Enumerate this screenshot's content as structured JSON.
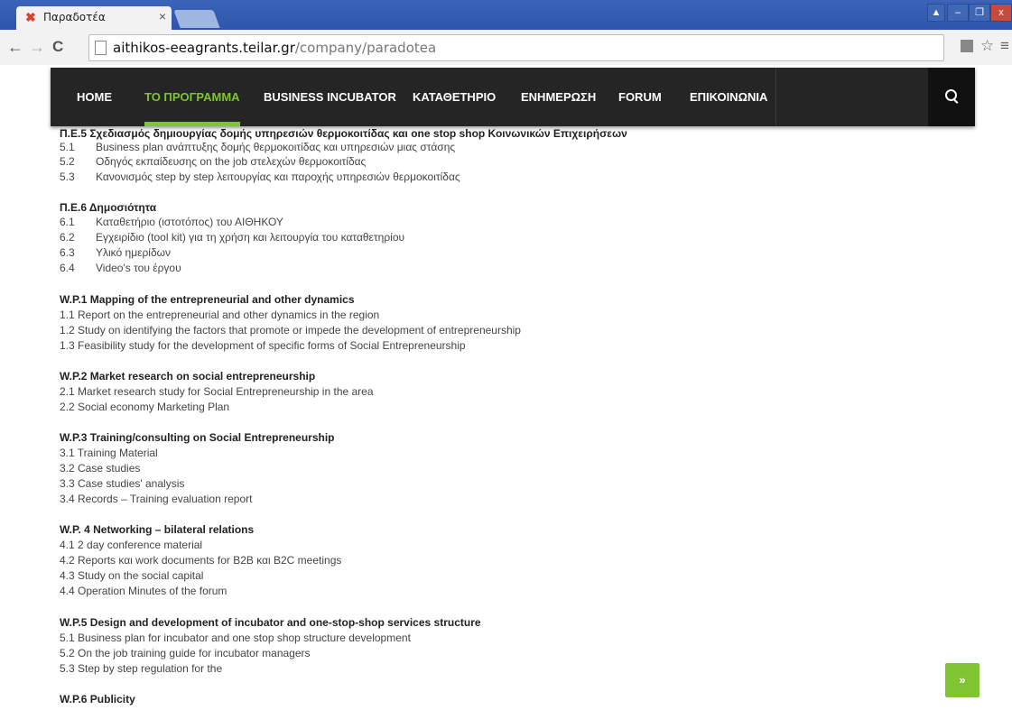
{
  "browser": {
    "tab_title": "Παραδοτέα",
    "tab_close": "×",
    "url_host": "aithikos-eeagrants.teilar.gr",
    "url_path": "/company/paradotea",
    "icons": {
      "back": "←",
      "forward": "→",
      "reload": "C",
      "translate": "​",
      "bookmark": "☆",
      "menu": "≡"
    },
    "window_controls": [
      "▲",
      "–",
      "❐",
      "x"
    ]
  },
  "nav": {
    "items": [
      "HOME",
      "ΤΟ ΠΡΟΓΡΑΜΜΑ",
      "BUSINESS INCUBATOR",
      "ΚΑΤΑΘΕΤΗΡΙΟ",
      "ΕΝΗΜΕΡΩΣΗ",
      "FORUM",
      "ΕΠΙΚΟΙΝΩΝΙΑ"
    ],
    "active": "ΤΟ ΠΡΟΓΡΑΜΜΑ"
  },
  "content": {
    "partial_heading": "Π.Ε.5 Σχεδιασμός δημιουργίας δομής υπηρεσιών θερμοκοιτίδας και one stop shop Κοινωνικών Επιχειρήσεων",
    "pe5": [
      {
        "num": "5.1",
        "text": "Business plan ανάπτυξης δομής θερμοκοιτίδας και υπηρεσιών μιας στάσης"
      },
      {
        "num": "5.2",
        "text": "Οδηγός εκπαίδευσης on the job στελεχών θερμοκοιτίδας"
      },
      {
        "num": "5.3",
        "text": "Κανονισμός step by step λειτουργίας και παροχής υπηρεσιών θερμοκοιτίδας"
      }
    ],
    "pe6_title": "Π.Ε.6 Δημοσιότητα",
    "pe6": [
      {
        "num": "6.1",
        "text": "Καταθετήριο (ιστοτόπος) του ΑΙΘΗΚΟΥ"
      },
      {
        "num": "6.2",
        "text": "Εγχειρίδιο (tool kit) για τη χρήση και λειτουργία του καταθετηρίου"
      },
      {
        "num": "6.3",
        "text": "Υλικό ημερίδων"
      },
      {
        "num": "6.4",
        "text": "Video's του έργου"
      }
    ],
    "wp1_title": "W.P.1 Mapping of the entrepreneurial and other dynamics",
    "wp1": [
      "1.1 Report on the entrepreneurial and other dynamics in the region",
      "1.2 Study on identifying the factors that promote or impede the development of entrepreneurship",
      "1.3 Feasibility study for the development of specific forms of Social Entrepreneurship"
    ],
    "wp2_title": "W.P.2 Market research on social entrepreneurship",
    "wp2": [
      "2.1 Market research study for Social Entrepreneurship in the area",
      "2.2 Social economy Marketing Plan"
    ],
    "wp3_title": "W.P.3 Training/consulting on Social Entrepreneurship",
    "wp3": [
      "3.1 Training Material",
      "3.2 Case studies",
      "3.3 Case studies' analysis",
      "3.4 Records – Training evaluation report"
    ],
    "wp4_title": "W.P. 4 Networking – bilateral relations",
    "wp4": [
      "4.1 2 day conference material",
      "4.2 Reports και work documents for B2B και B2C meetings",
      "4.3 Study on the social capital",
      "4.4 Operation Minutes of the forum"
    ],
    "wp5_title": "W.P.5 Design and development of incubator and one-stop-shop services structure",
    "wp5": [
      "5.1 Business plan for incubator and one stop shop structure development",
      "5.2 On the job training guide for incubator managers",
      "5.3 Step by step regulation for the"
    ],
    "wp6_title": "W.P.6 Publicity"
  },
  "back_to_top": "»",
  "colors": {
    "nav_bg": "#252525",
    "accent": "#7fc431",
    "chrome_blue": "#3b63b8"
  }
}
